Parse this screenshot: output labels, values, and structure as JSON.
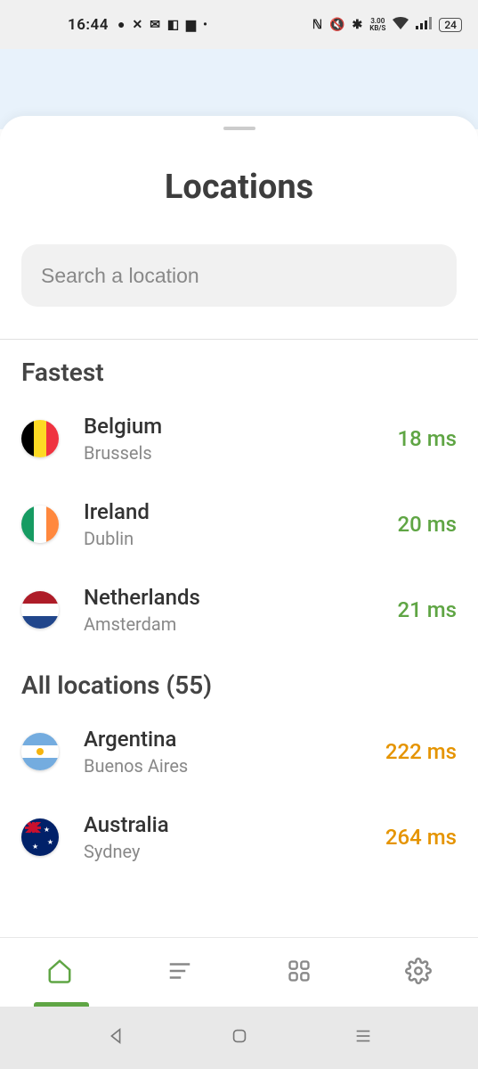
{
  "status": {
    "time": "16:44",
    "kbs_top": "3.00",
    "kbs_bottom": "KB/S",
    "battery": "24"
  },
  "sheet": {
    "title": "Locations",
    "search_placeholder": "Search a location"
  },
  "sections": {
    "fastest_label": "Fastest",
    "all_label": "All locations (55)"
  },
  "fastest": [
    {
      "country": "Belgium",
      "city": "Brussels",
      "ping": "18 ms"
    },
    {
      "country": "Ireland",
      "city": "Dublin",
      "ping": "20 ms"
    },
    {
      "country": "Netherlands",
      "city": "Amsterdam",
      "ping": "21 ms"
    }
  ],
  "all": [
    {
      "country": "Argentina",
      "city": "Buenos Aires",
      "ping": "222 ms"
    },
    {
      "country": "Australia",
      "city": "Sydney",
      "ping": "264 ms"
    }
  ]
}
